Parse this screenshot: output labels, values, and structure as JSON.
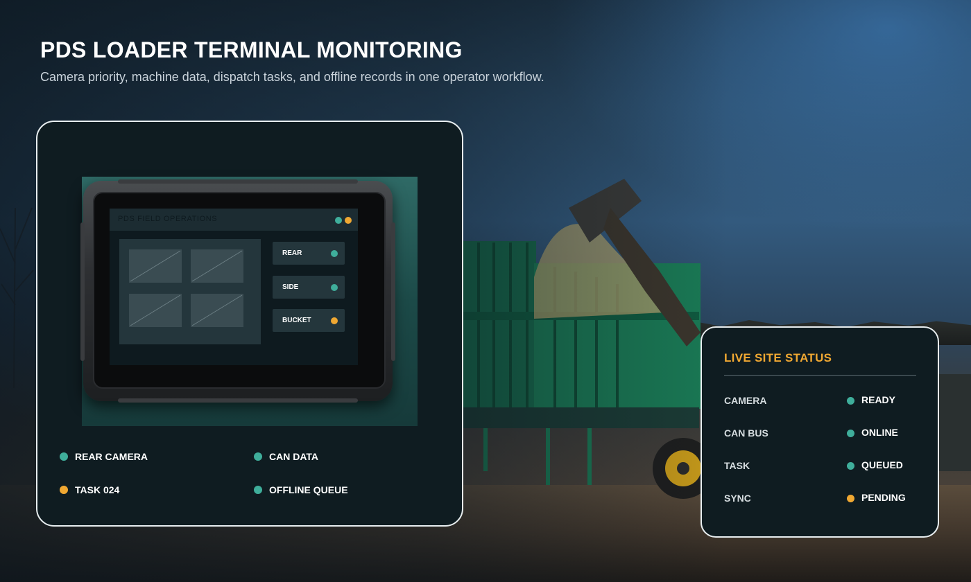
{
  "page": {
    "title": "PDS LOADER TERMINAL MONITORING",
    "subtitle": "Camera priority, machine data, dispatch tasks, and offline records in one operator workflow."
  },
  "colors": {
    "teal": "#3fae9b",
    "amber": "#f0a832",
    "card_bg": "#0f1c21"
  },
  "device": {
    "screen_title": "PDS FIELD OPERATIONS",
    "header_dots": [
      "teal",
      "amber"
    ],
    "camera_buttons": [
      {
        "label": "REAR",
        "status": "teal"
      },
      {
        "label": "SIDE",
        "status": "teal"
      },
      {
        "label": "BUCKET",
        "status": "amber"
      }
    ]
  },
  "feature_status": [
    {
      "label": "REAR CAMERA",
      "status": "teal"
    },
    {
      "label": "CAN DATA",
      "status": "teal"
    },
    {
      "label": "TASK 024",
      "status": "amber"
    },
    {
      "label": "OFFLINE QUEUE",
      "status": "teal"
    }
  ],
  "live_status": {
    "title": "LIVE SITE STATUS",
    "rows": [
      {
        "label": "CAMERA",
        "value": "READY",
        "status": "teal"
      },
      {
        "label": "CAN BUS",
        "value": "ONLINE",
        "status": "teal"
      },
      {
        "label": "TASK",
        "value": "QUEUED",
        "status": "teal"
      },
      {
        "label": "SYNC",
        "value": "PENDING",
        "status": "amber"
      }
    ]
  }
}
